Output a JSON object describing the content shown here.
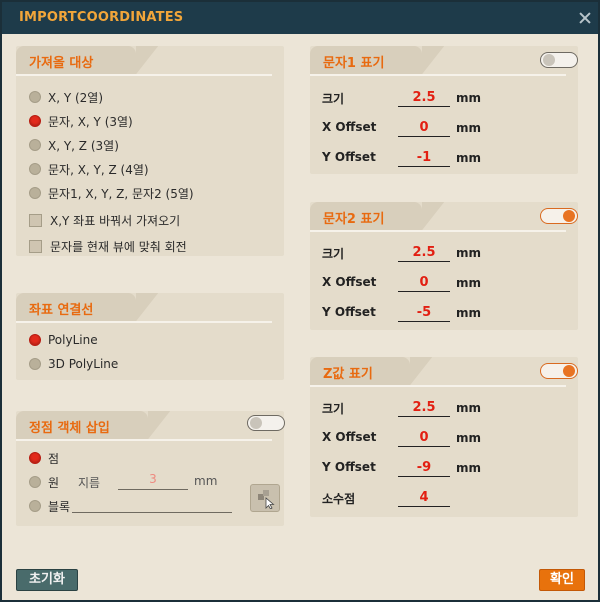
{
  "dialog": {
    "title": "IMPORTCOORDINATES"
  },
  "import_target": {
    "title": "가져올 대상",
    "options": [
      {
        "label": "X, Y (2열)",
        "selected": false
      },
      {
        "label": "문자, X, Y (3열)",
        "selected": true
      },
      {
        "label": "X, Y, Z (3열)",
        "selected": false
      },
      {
        "label": "문자, X, Y, Z (4열)",
        "selected": false
      },
      {
        "label": "문자1, X, Y, Z, 문자2 (5열)",
        "selected": false
      }
    ],
    "checkboxes": [
      {
        "label": "X,Y 좌표 바꿔서 가져오기",
        "checked": false
      },
      {
        "label": "문자를 현재 뷰에 맞춰 회전",
        "checked": false
      }
    ]
  },
  "connect_line": {
    "title": "좌표 연결선",
    "options": [
      {
        "label": "PolyLine",
        "selected": true
      },
      {
        "label": "3D PolyLine",
        "selected": false
      }
    ]
  },
  "vertex_insert": {
    "title": "정점 객체 삽입",
    "toggle_on": false,
    "options": [
      {
        "label": "점",
        "selected": true
      },
      {
        "label": "원",
        "selected": false
      },
      {
        "label": "블록",
        "selected": false
      }
    ],
    "diameter_label": "지름",
    "diameter_value": "3",
    "diameter_unit": "mm",
    "pick_icon": "block-pick-icon"
  },
  "text1": {
    "title": "문자1 표기",
    "toggle_on": false,
    "size_label": "크기",
    "size_value": "2.5",
    "size_unit": "mm",
    "xoff_label": "X Offset",
    "xoff_value": "0",
    "xoff_unit": "mm",
    "yoff_label": "Y Offset",
    "yoff_value": "-1",
    "yoff_unit": "mm"
  },
  "text2": {
    "title": "문자2 표기",
    "toggle_on": true,
    "size_label": "크기",
    "size_value": "2.5",
    "size_unit": "mm",
    "xoff_label": "X Offset",
    "xoff_value": "0",
    "xoff_unit": "mm",
    "yoff_label": "Y Offset",
    "yoff_value": "-5",
    "yoff_unit": "mm"
  },
  "zvalue": {
    "title": "Z값 표기",
    "toggle_on": true,
    "size_label": "크기",
    "size_value": "2.5",
    "size_unit": "mm",
    "xoff_label": "X Offset",
    "xoff_value": "0",
    "xoff_unit": "mm",
    "yoff_label": "Y Offset",
    "yoff_value": "-9",
    "yoff_unit": "mm",
    "decimals_label": "소수점",
    "decimals_value": "4"
  },
  "buttons": {
    "reset": "초기화",
    "ok": "확인"
  },
  "colors": {
    "accent": "#e86a10",
    "title": "#f2a63a",
    "value_red": "#e21f12",
    "titlebar": "#1e3b4a"
  }
}
